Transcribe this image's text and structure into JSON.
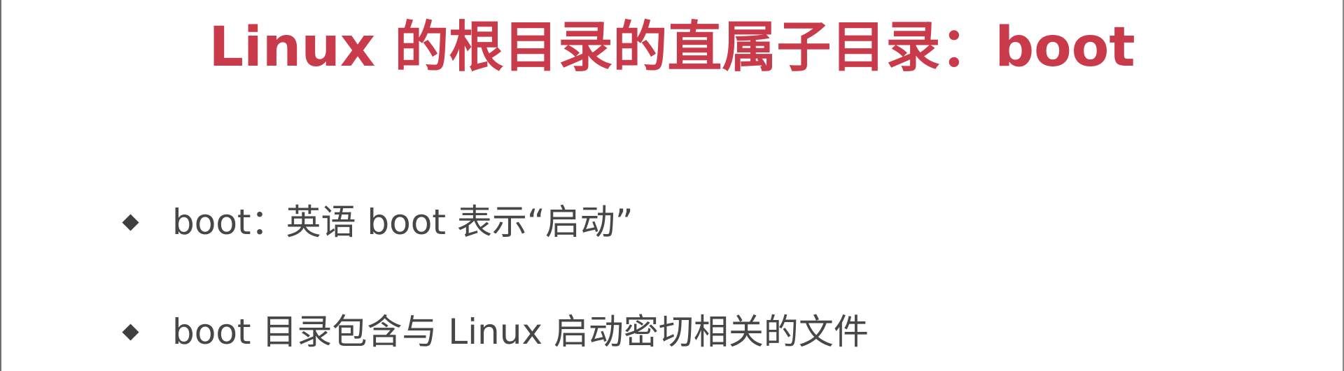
{
  "slide": {
    "title": "Linux 的根目录的直属子目录：boot",
    "title_color": "#c93a4a",
    "bullet_icon": "diamond-bullet-icon",
    "bullets": [
      {
        "text": "boot：英语 boot 表示“启动”"
      },
      {
        "text": "boot 目录包含与 Linux 启动密切相关的文件"
      }
    ]
  }
}
